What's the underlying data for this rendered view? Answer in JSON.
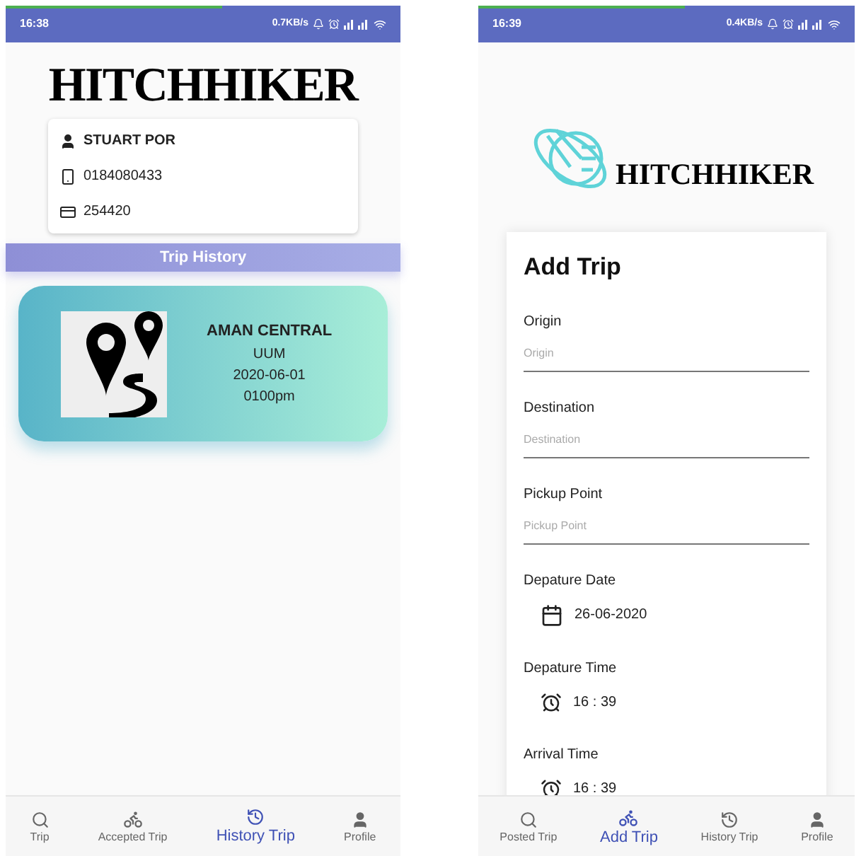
{
  "screens": [
    {
      "status_bar": {
        "time": "16:38",
        "speed": "0.7KB/s"
      },
      "logo": "HITCHHIKER",
      "profile": {
        "name": "STUART POR",
        "phone": "0184080433",
        "card": "254420"
      },
      "section_title": "Trip History",
      "trips": [
        {
          "title": "AMAN CENTRAL",
          "place": "UUM",
          "date": "2020-06-01",
          "time": "0100pm"
        }
      ],
      "nav": [
        {
          "label": "Trip",
          "kind": "search",
          "selected": false
        },
        {
          "label": "Accepted Trip",
          "kind": "bike",
          "selected": false
        },
        {
          "label": "History Trip",
          "kind": "history",
          "selected": true
        },
        {
          "label": "Profile",
          "kind": "user",
          "selected": false
        }
      ]
    },
    {
      "status_bar": {
        "time": "16:39",
        "speed": "0.4KB/s"
      },
      "logo": "HITCHHIKER",
      "form": {
        "title": "Add Trip",
        "fields": [
          {
            "kind": "text",
            "label": "Origin",
            "placeholder": "Origin"
          },
          {
            "kind": "text",
            "label": "Destination",
            "placeholder": "Destination"
          },
          {
            "kind": "text",
            "label": "Pickup Point",
            "placeholder": "Pickup Point"
          },
          {
            "kind": "date",
            "label": "Depature Date",
            "value": "26-06-2020"
          },
          {
            "kind": "time",
            "label": "Depature Time",
            "value": "16 : 39"
          },
          {
            "kind": "time",
            "label": "Arrival Time",
            "value": "16 : 39"
          }
        ]
      },
      "nav": [
        {
          "label": "Posted Trip",
          "kind": "search",
          "selected": false
        },
        {
          "label": "Add Trip",
          "kind": "bike",
          "selected": true
        },
        {
          "label": "History Trip",
          "kind": "history",
          "selected": false
        },
        {
          "label": "Profile",
          "kind": "user",
          "selected": false
        }
      ]
    }
  ]
}
